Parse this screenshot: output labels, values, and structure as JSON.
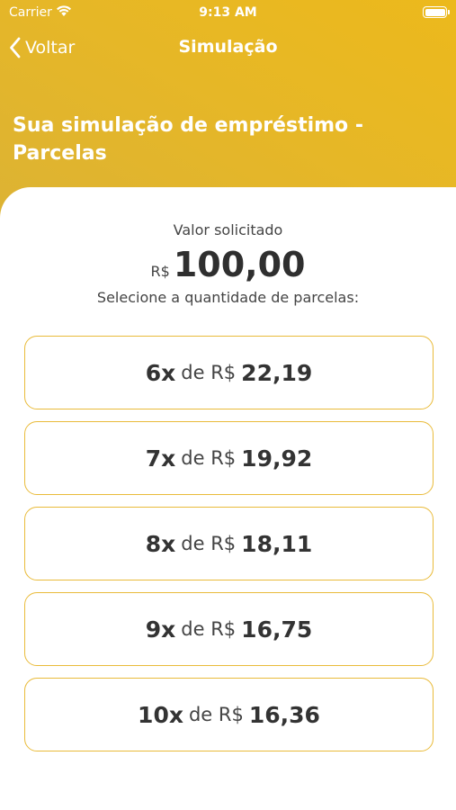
{
  "status_bar": {
    "carrier": "Carrier",
    "time": "9:13 AM",
    "wifi_icon": "wifi-icon",
    "battery_icon": "battery-icon"
  },
  "nav": {
    "back_label": "Voltar",
    "back_icon": "chevron-left-icon",
    "title": "Simulação"
  },
  "heading": "Sua simulação de empréstimo - Parcelas",
  "amount": {
    "caption": "Valor solicitado",
    "currency": "R$",
    "value": "100,00"
  },
  "select_prompt": "Selecione a quantidade de parcelas:",
  "installments": [
    {
      "count": "6x",
      "sep": "de R$",
      "price": "22,19"
    },
    {
      "count": "7x",
      "sep": "de R$",
      "price": "19,92"
    },
    {
      "count": "8x",
      "sep": "de R$",
      "price": "18,11"
    },
    {
      "count": "9x",
      "sep": "de R$",
      "price": "16,75"
    },
    {
      "count": "10x",
      "sep": "de R$",
      "price": "16,36"
    }
  ],
  "colors": {
    "header_gradient_start": "#dbb235",
    "header_gradient_end": "#ecb91c",
    "option_border": "#e9bb3a",
    "text_dark": "#333333"
  }
}
